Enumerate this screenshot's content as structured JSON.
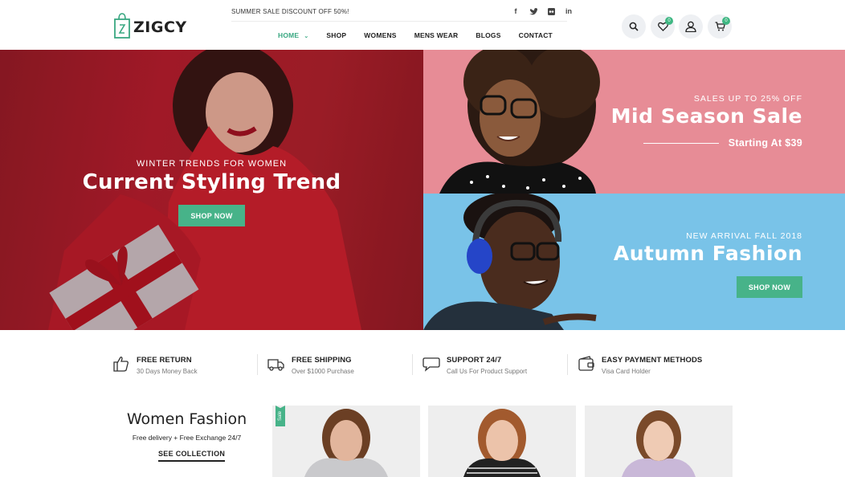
{
  "brand": {
    "name": "ZIGCY",
    "accent": "#47b389"
  },
  "topbar": {
    "promo": "SUMMER SALE DISCOUNT OFF 50%!",
    "socials": [
      "facebook-icon",
      "twitter-icon",
      "flickr-icon",
      "linkedin-icon"
    ]
  },
  "nav": {
    "items": [
      {
        "label": "HOME",
        "active": true
      },
      {
        "label": "SHOP"
      },
      {
        "label": "WOMENS"
      },
      {
        "label": "MENS WEAR"
      },
      {
        "label": "BLOGS"
      },
      {
        "label": "CONTACT"
      }
    ]
  },
  "header_icons": {
    "wishlist_count": "0",
    "cart_count": "0"
  },
  "hero": {
    "left": {
      "subtitle": "WINTER TRENDS FOR WOMEN",
      "title": "Current Styling Trend",
      "button": "SHOP NOW"
    },
    "top_right": {
      "subtitle": "SALES UP TO 25% OFF",
      "title": "Mid Season Sale",
      "price": "Starting At $39"
    },
    "bottom_right": {
      "subtitle": "NEW ARRIVAL FALL 2018",
      "title": "Autumn Fashion",
      "button": "SHOP NOW"
    }
  },
  "features": [
    {
      "icon": "thumbs-up-icon",
      "title": "FREE RETURN",
      "subtitle": "30 Days Money Back"
    },
    {
      "icon": "truck-icon",
      "title": "FREE SHIPPING",
      "subtitle": "Over $1000 Purchase"
    },
    {
      "icon": "chat-icon",
      "title": "SUPPORT 24/7",
      "subtitle": "Call Us For Product Support"
    },
    {
      "icon": "wallet-icon",
      "title": "EASY PAYMENT METHODS",
      "subtitle": "Visa Card Holder"
    }
  ],
  "collection": {
    "title": "Women Fashion",
    "subtitle": "Free delivery + Free Exchange 24/7",
    "link": "SEE COLLECTION",
    "sale_label": "Sale"
  }
}
